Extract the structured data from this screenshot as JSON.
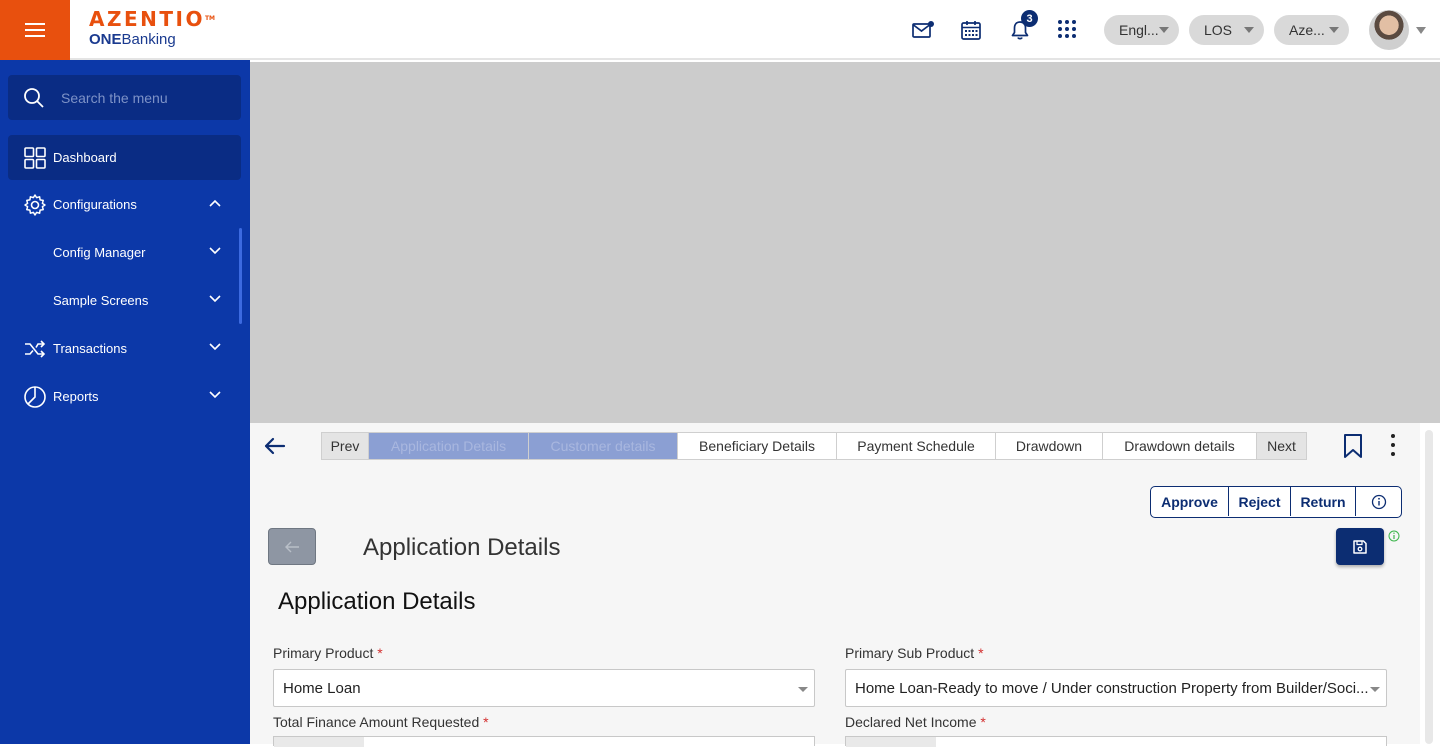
{
  "header": {
    "logo_main": "AZENTIO",
    "logo_tm": "TM",
    "logo_sub_bold": "ONE",
    "logo_sub_rest": "Banking",
    "notification_count": "3",
    "language": "Engl...",
    "module": "LOS",
    "entity": "Aze...",
    "icons": [
      "menu-icon",
      "mail-icon",
      "calendar-icon",
      "bell-icon",
      "apps-grid-icon",
      "avatar"
    ]
  },
  "sidebar": {
    "search_placeholder": "Search the menu",
    "items": [
      {
        "label": "Dashboard",
        "icon": "dashboard-icon"
      },
      {
        "label": "Configurations",
        "icon": "gear-icon",
        "expanded": true
      },
      {
        "label": "Config Manager"
      },
      {
        "label": "Sample Screens"
      },
      {
        "label": "Transactions",
        "icon": "shuffle-icon"
      },
      {
        "label": "Reports",
        "icon": "pie-chart-icon"
      }
    ]
  },
  "tabs": {
    "prev": "Prev",
    "next": "Next",
    "items": [
      "Application Details",
      "Customer details",
      "Beneficiary Details",
      "Payment Schedule",
      "Drawdown",
      "Drawdown details"
    ]
  },
  "actions": {
    "approve": "Approve",
    "reject": "Reject",
    "return": "Return"
  },
  "page": {
    "title": "Application Details",
    "section_title": "Application Details"
  },
  "form": {
    "primary_product_label": "Primary Product",
    "primary_product_value": "Home Loan",
    "primary_sub_product_label": "Primary Sub Product",
    "primary_sub_product_value": "Home Loan-Ready to move / Under construction Property from Builder/Soci...",
    "total_finance_label": "Total Finance Amount Requested",
    "declared_income_label": "Declared Net Income",
    "required_mark": "*"
  },
  "colors": {
    "brand_orange": "#e8500e",
    "sidebar_blue": "#0c38a8",
    "navy": "#0c2d72"
  }
}
